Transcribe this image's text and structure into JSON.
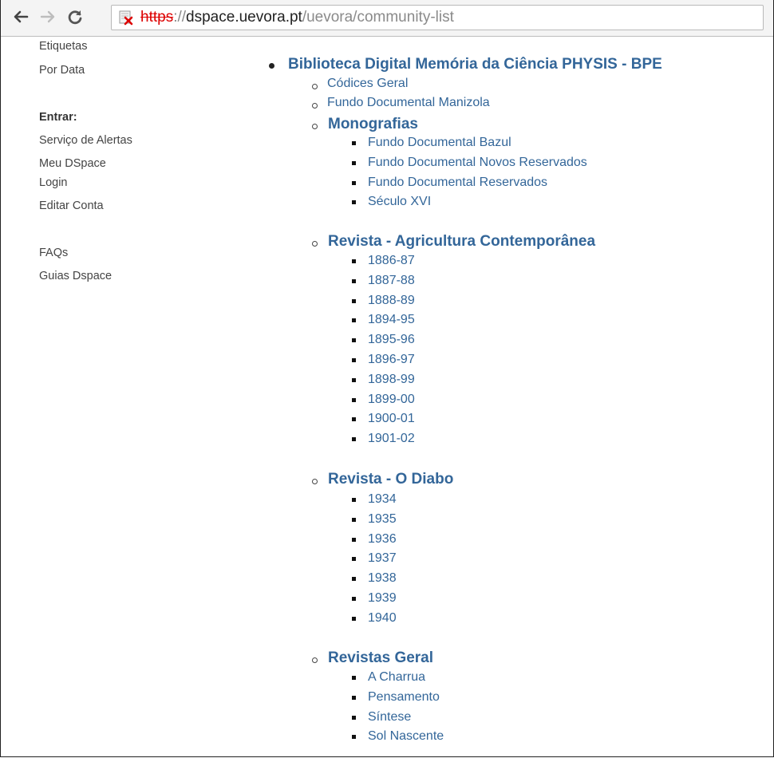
{
  "browser": {
    "url_scheme": "https",
    "url_separator": "://",
    "url_host": "dspace.uevora.pt",
    "url_path": "/uevora/community-list"
  },
  "sidebar": {
    "browse_items": [
      "Etiquetas",
      "Por Data"
    ],
    "login_heading": "Entrar:",
    "login_items": [
      "Serviço de Alertas",
      "Meu DSpace",
      "Login",
      "Editar Conta"
    ],
    "help_items": [
      "FAQs",
      "Guias Dspace"
    ]
  },
  "community": {
    "title": "Biblioteca Digital Memória da Ciência PHYSIS - BPE",
    "collections": [
      "Códices Geral",
      "Fundo Documental Manizola"
    ],
    "subcommunities": [
      {
        "title": "Monografias",
        "items": [
          "Fundo Documental Bazul",
          "Fundo Documental Novos Reservados",
          "Fundo Documental Reservados",
          "Século XVI"
        ]
      },
      {
        "title": "Revista - Agricultura Contemporânea",
        "items": [
          "1886-87",
          "1887-88",
          "1888-89",
          "1894-95",
          "1895-96",
          "1896-97",
          "1898-99",
          "1899-00",
          "1900-01",
          "1901-02"
        ]
      },
      {
        "title": "Revista - O Diabo",
        "items": [
          "1934",
          "1935",
          "1936",
          "1937",
          "1938",
          "1939",
          "1940"
        ]
      },
      {
        "title": "Revistas Geral",
        "items": [
          "A Charrua",
          "Pensamento",
          "Síntese",
          "Sol Nascente"
        ]
      }
    ]
  }
}
